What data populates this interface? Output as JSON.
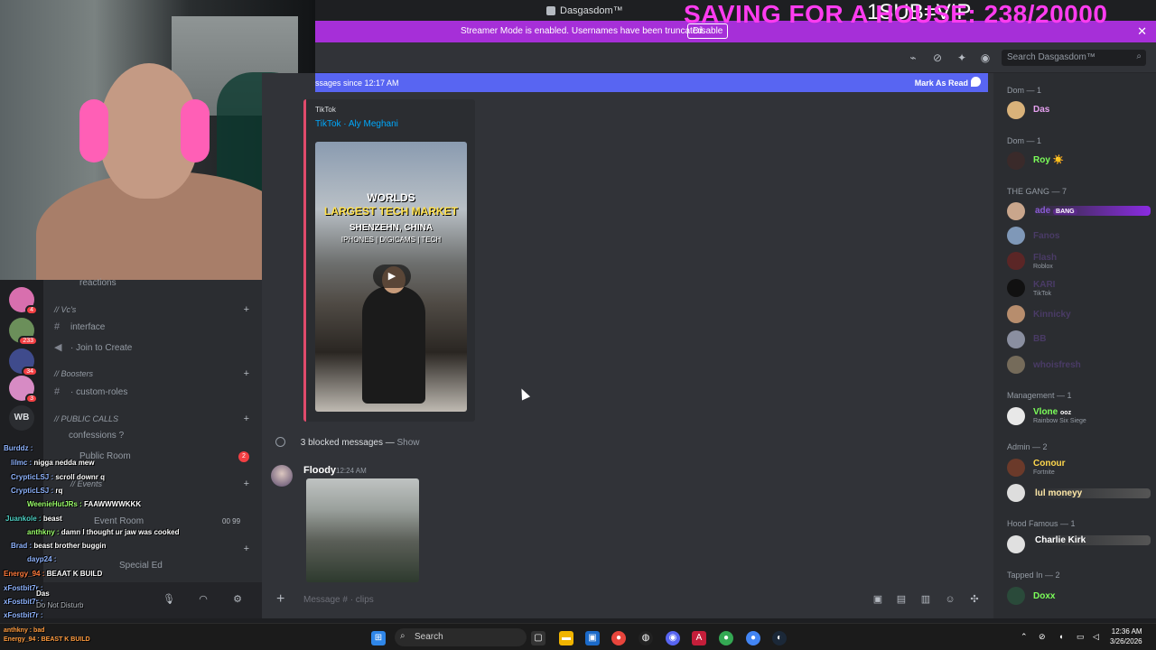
{
  "window": {
    "title": "Dasgasdom™"
  },
  "overlay": {
    "goal_text": "SAVING FOR A HOUSE: 238/20000",
    "sub_text": "1SUB=VIP"
  },
  "banner": {
    "text": "Streamer Mode is enabled. Usernames have been truncated.",
    "disable_label": "Disable",
    "close": "✕"
  },
  "header": {
    "search_placeholder": "Search Dasgasdom™"
  },
  "newbar": {
    "text": "ssages since 12:17 AM",
    "action": "Mark As Read"
  },
  "embed": {
    "provider": "TikTok",
    "author": "TikTok · Aly Meghani",
    "caption_line1": "WORLDS",
    "caption_line2": "LARGEST TECH MARKET",
    "caption_line3": "SHENZEHN, CHINA",
    "caption_line4": "IPHONES | DIGICAMS | TECH",
    "play": "▶"
  },
  "blocked": {
    "text": "3 blocked messages — ",
    "show": "Show"
  },
  "message": {
    "author": "Floody",
    "time": "12:24 AM"
  },
  "composer": {
    "placeholder": "Message # · clips",
    "plus": "+"
  },
  "servers": {
    "badges": [
      "4",
      "233",
      "34",
      "3"
    ],
    "wb_label": "WB"
  },
  "channels": {
    "top_partial": "reactions",
    "cat_vcs": "// Vc's",
    "ch_interface": "interface",
    "ch_join": "· Join to Create",
    "cat_boosters": "// Boosters",
    "ch_custom_roles": "· custom-roles",
    "cat_public_calls": "// PUBLIC CALLS",
    "ch_confessions": "confessions ?",
    "ch_public_room": "Public Room",
    "public_room_badge": "2",
    "cat_events": "// Events",
    "ch_event_room": "Event Room",
    "event_count": "00  99",
    "ch_special_ed": "Special Ed"
  },
  "user": {
    "name": "Das",
    "status": "Do Not Disturb"
  },
  "stream_chat": [
    {
      "name": "Burddz :",
      "text": ""
    },
    {
      "name": "lilmc :",
      "text": "nigga nedda mew"
    },
    {
      "name": "CrypticLSJ :",
      "text": "scroll downr q"
    },
    {
      "name": "CrypticLSJ :",
      "text": "rq"
    },
    {
      "name": "WeenieHutJRs :",
      "text": "FAAWWWWKKK"
    },
    {
      "name": "Juankole :",
      "text": "beast"
    },
    {
      "name": "anthkny :",
      "text": "damn I thought ur jaw was cooked"
    },
    {
      "name": "Brad :",
      "text": "beast brother buggin"
    },
    {
      "name": "dayp24 :",
      "text": ""
    },
    {
      "name": "Energy_94 :",
      "text": "BEAAT K BUILD"
    },
    {
      "name": "xFostbit7r :",
      "text": ""
    },
    {
      "name": "xFostbit7r :",
      "text": ""
    },
    {
      "name": "xFostbit7r :",
      "text": ""
    }
  ],
  "members": {
    "groups": [
      {
        "title": "Dom — 1"
      },
      {
        "title": "Dom — 1"
      },
      {
        "title": "THE GANG — 7"
      },
      {
        "title": "Management — 1"
      },
      {
        "title": "Admin — 2"
      },
      {
        "title": "Hood Famous — 1"
      },
      {
        "title": "Tapped In — 2"
      }
    ],
    "names": {
      "das": "Das",
      "roy": "Roy ☀️",
      "gang1": "ade",
      "gang1_tag": "BANG",
      "gang2": "Fanos",
      "gang3": "Flash",
      "gang3_sub": "Roblox",
      "gang4": "KARI",
      "gang4_sub": "TikTok",
      "gang5": "Kinnicky",
      "gang6": "BB",
      "gang7": "whoisfresh",
      "mgmt": "Vlone",
      "mgmt_tag": "ooz",
      "mgmt_sub": "Rainbow Six Siege",
      "admin1": "Conour",
      "admin1_sub": "Fortnite",
      "admin2": "lul moneyy",
      "hood": "Charlie Kirk",
      "tapped": "Doxx"
    }
  },
  "taskbar": {
    "search": "Search",
    "time": "12:36 AM",
    "date": "3/26/2026",
    "left_note": "Energy_94 : BEAST K BUILD",
    "left_note2": "anthkny : bad"
  },
  "colors": {
    "accent": "#5865f2",
    "banner": "#a62fd8",
    "overlay": "#ff3cf0"
  }
}
